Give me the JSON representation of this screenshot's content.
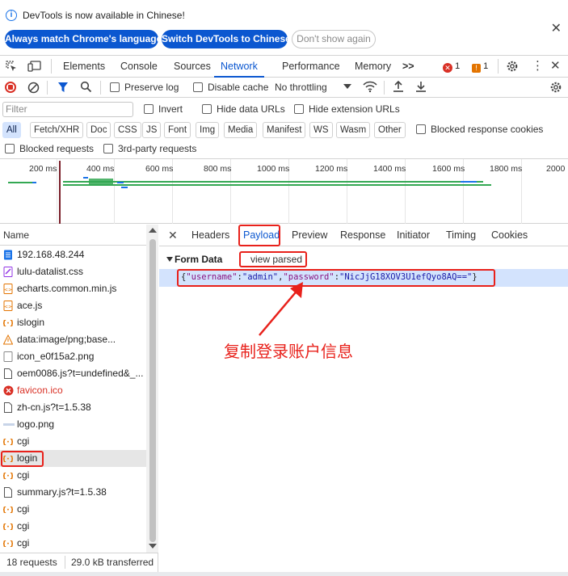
{
  "infobar": {
    "message": "DevTools is now available in Chinese!",
    "btn_match": "Always match Chrome's language",
    "btn_switch": "Switch DevTools to Chinese",
    "btn_dont_show": "Don't show again"
  },
  "tabs": {
    "elements": "Elements",
    "console": "Console",
    "sources": "Sources",
    "network": "Network",
    "performance": "Performance",
    "memory": "Memory",
    "more": ">>",
    "error_count": "1",
    "warning_count": "1"
  },
  "toolbar": {
    "preserve_log": "Preserve log",
    "disable_cache": "Disable cache",
    "throttling": "No throttling"
  },
  "filter": {
    "placeholder": "Filter",
    "invert": "Invert",
    "hide_data_urls": "Hide data URLs",
    "hide_extension_urls": "Hide extension URLs",
    "types": [
      "All",
      "Fetch/XHR",
      "Doc",
      "CSS",
      "JS",
      "Font",
      "Img",
      "Media",
      "Manifest",
      "WS",
      "Wasm",
      "Other"
    ],
    "active_type": "All",
    "blocked_response_cookies": "Blocked response cookies",
    "blocked_requests": "Blocked requests",
    "third_party": "3rd-party requests"
  },
  "overview": {
    "ticks": [
      "200 ms",
      "400 ms",
      "600 ms",
      "800 ms",
      "1000 ms",
      "1200 ms",
      "1400 ms",
      "1600 ms",
      "1800 ms",
      "2000"
    ]
  },
  "requests": {
    "header": "Name",
    "items": [
      {
        "name": "192.168.48.244",
        "icon": "document-icon",
        "error": false
      },
      {
        "name": "lulu-datalist.css",
        "icon": "stylesheet-icon",
        "error": false
      },
      {
        "name": "echarts.common.min.js",
        "icon": "script-icon",
        "error": false
      },
      {
        "name": "ace.js",
        "icon": "script-icon",
        "error": false
      },
      {
        "name": "islogin",
        "icon": "xhr-icon",
        "error": false
      },
      {
        "name": "data:image/png;base...",
        "icon": "warning-icon",
        "error": false
      },
      {
        "name": "icon_e0f15a2.png",
        "icon": "image-icon",
        "error": false
      },
      {
        "name": "oem0086.js?t=undefined&_...",
        "icon": "file-icon",
        "error": false
      },
      {
        "name": "favicon.ico",
        "icon": "error-icon",
        "error": true
      },
      {
        "name": "zh-cn.js?t=1.5.38",
        "icon": "file-icon",
        "error": false
      },
      {
        "name": "logo.png",
        "icon": "image-thumb-icon",
        "error": false
      },
      {
        "name": "cgi",
        "icon": "xhr-icon",
        "error": false
      },
      {
        "name": "login",
        "icon": "xhr-icon",
        "error": false
      },
      {
        "name": "cgi",
        "icon": "xhr-icon",
        "error": false
      },
      {
        "name": "summary.js?t=1.5.38",
        "icon": "file-icon",
        "error": false
      },
      {
        "name": "cgi",
        "icon": "xhr-icon",
        "error": false
      },
      {
        "name": "cgi",
        "icon": "xhr-icon",
        "error": false
      },
      {
        "name": "cgi",
        "icon": "xhr-icon",
        "error": false
      }
    ],
    "selected_index": 12
  },
  "status": {
    "requests": "18 requests",
    "transferred": "29.0 kB transferred"
  },
  "detail": {
    "tabs": [
      "Headers",
      "Payload",
      "Preview",
      "Response",
      "Initiator",
      "Timing",
      "Cookies"
    ],
    "active_tab": "Payload",
    "section_title": "Form Data",
    "view_parsed": "view parsed",
    "payload_open": "{",
    "key_username": "\"username\"",
    "colon1": ":",
    "val_username": "\"admin\"",
    "comma": ",",
    "key_password": "\"password\"",
    "colon2": ":",
    "val_password": "\"NicJjG18XOV3U1efQyo8AQ==\"",
    "payload_close": "}"
  },
  "annotation": {
    "text": "复制登录账户信息",
    "color": "#e8211b"
  },
  "colors": {
    "accent": "#0b57d0",
    "highlight": "#d3e3fd",
    "error": "#d93025",
    "warning": "#e37400",
    "annotation": "#e8211b"
  }
}
